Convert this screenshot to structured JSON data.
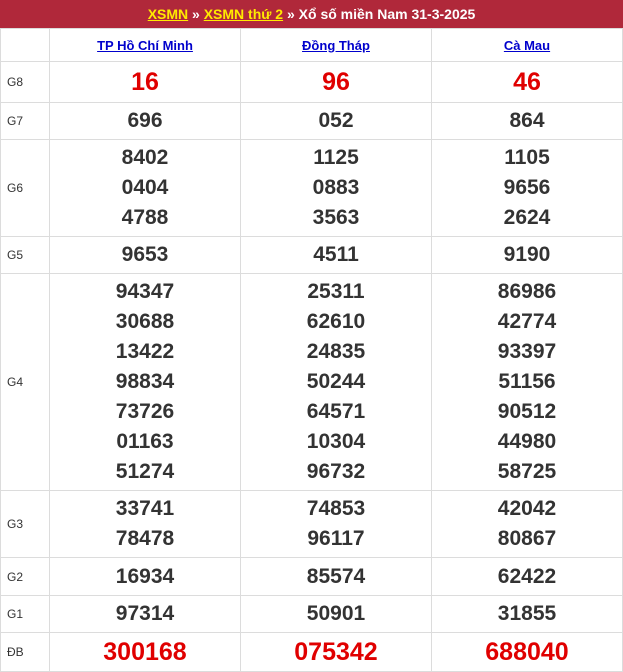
{
  "header": {
    "link1": "XSMN",
    "sep1": " » ",
    "link2": "XSMN thứ 2",
    "sep2": " » ",
    "title": "Xổ số miền Nam 31-3-2025"
  },
  "provinces": [
    "TP Hồ Chí Minh",
    "Đồng Tháp",
    "Cà Mau"
  ],
  "rows": {
    "g8": {
      "label": "G8",
      "values": [
        [
          "16"
        ],
        [
          "96"
        ],
        [
          "46"
        ]
      ]
    },
    "g7": {
      "label": "G7",
      "values": [
        [
          "696"
        ],
        [
          "052"
        ],
        [
          "864"
        ]
      ]
    },
    "g6": {
      "label": "G6",
      "values": [
        [
          "8402",
          "0404",
          "4788"
        ],
        [
          "1125",
          "0883",
          "3563"
        ],
        [
          "1105",
          "9656",
          "2624"
        ]
      ]
    },
    "g5": {
      "label": "G5",
      "values": [
        [
          "9653"
        ],
        [
          "4511"
        ],
        [
          "9190"
        ]
      ]
    },
    "g4": {
      "label": "G4",
      "values": [
        [
          "94347",
          "30688",
          "13422",
          "98834",
          "73726",
          "01163",
          "51274"
        ],
        [
          "25311",
          "62610",
          "24835",
          "50244",
          "64571",
          "10304",
          "96732"
        ],
        [
          "86986",
          "42774",
          "93397",
          "51156",
          "90512",
          "44980",
          "58725"
        ]
      ]
    },
    "g3": {
      "label": "G3",
      "values": [
        [
          "33741",
          "78478"
        ],
        [
          "74853",
          "96117"
        ],
        [
          "42042",
          "80867"
        ]
      ]
    },
    "g2": {
      "label": "G2",
      "values": [
        [
          "16934"
        ],
        [
          "85574"
        ],
        [
          "62422"
        ]
      ]
    },
    "g1": {
      "label": "G1",
      "values": [
        [
          "97314"
        ],
        [
          "50901"
        ],
        [
          "31855"
        ]
      ]
    },
    "db": {
      "label": "ĐB",
      "values": [
        [
          "300168"
        ],
        [
          "075342"
        ],
        [
          "688040"
        ]
      ]
    }
  }
}
